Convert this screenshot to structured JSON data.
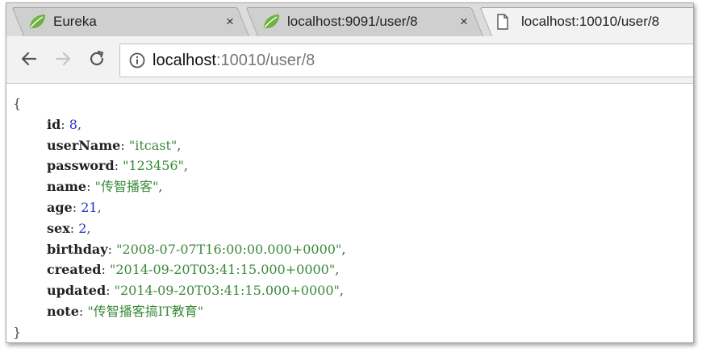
{
  "tabs": [
    {
      "label": "Eureka",
      "icon": "spring-leaf-icon",
      "close": "×"
    },
    {
      "label": "localhost:9091/user/8",
      "icon": "spring-leaf-icon",
      "close": "×"
    },
    {
      "label": "localhost:10010/user/8",
      "icon": "page-icon",
      "active": true
    }
  ],
  "address": {
    "host": "localhost",
    "path": ":10010/user/8"
  },
  "json_view": {
    "open_brace": "{",
    "close_brace": "}",
    "fields": [
      {
        "key": "id",
        "value": "8",
        "type": "number"
      },
      {
        "key": "userName",
        "value": "\"itcast\"",
        "type": "string"
      },
      {
        "key": "password",
        "value": "\"123456\"",
        "type": "string"
      },
      {
        "key": "name",
        "value": "\"传智播客\"",
        "type": "string"
      },
      {
        "key": "age",
        "value": "21",
        "type": "number"
      },
      {
        "key": "sex",
        "value": "2",
        "type": "number"
      },
      {
        "key": "birthday",
        "value": "\"2008-07-07T16:00:00.000+0000\"",
        "type": "string"
      },
      {
        "key": "created",
        "value": "\"2014-09-20T03:41:15.000+0000\"",
        "type": "string"
      },
      {
        "key": "updated",
        "value": "\"2014-09-20T03:41:15.000+0000\"",
        "type": "string"
      },
      {
        "key": "note",
        "value": "\"传智播客搞IT教育\"",
        "type": "string"
      }
    ]
  },
  "colors": {
    "key": "#222222",
    "string": "#3a8a3a",
    "number": "#2c2cc8"
  }
}
